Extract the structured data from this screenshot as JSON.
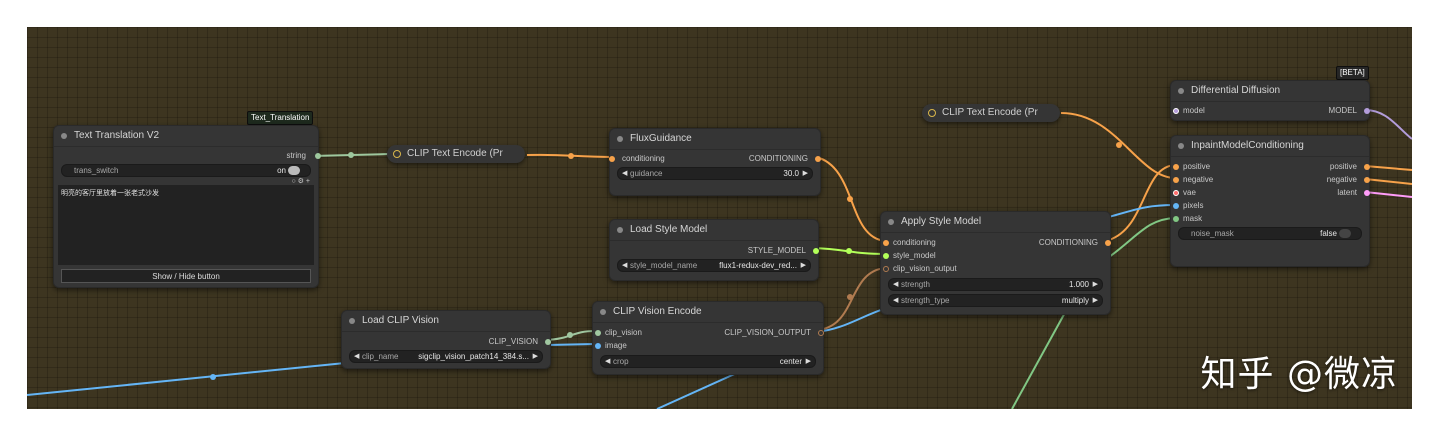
{
  "canvas": {
    "bg": "#3d3520"
  },
  "colors": {
    "conditioning": "#f7a24a",
    "clip_vision": "#a0c7a0",
    "image": "#64b5f6",
    "style_model": "#b2ff59",
    "clip_vision_output": "#b07b50",
    "string": "#9ec89e",
    "mask": "#81c784",
    "model": "#b39ddb",
    "vae": "#ff6e6e",
    "latent": "#ff9cf9"
  },
  "watermark": "知乎 @微凉",
  "nodes": {
    "text_translation": {
      "tag": "Text_Translation",
      "title": "Text Translation V2",
      "output_string": "string",
      "trans_switch_label": "trans_switch",
      "trans_switch_value": "on",
      "text": "明亮的客厅里放着一张老式沙发",
      "button_label": "Show / Hide button"
    },
    "clip_text_encode_1": {
      "title": "CLIP Text Encode (Pr"
    },
    "clip_text_encode_2": {
      "title": "CLIP Text Encode (Pr"
    },
    "flux_guidance": {
      "title": "FluxGuidance",
      "input_conditioning": "conditioning",
      "output_conditioning": "CONDITIONING",
      "guidance_label": "guidance",
      "guidance_value": "30.0"
    },
    "load_style_model": {
      "title": "Load Style Model",
      "output_style_model": "STYLE_MODEL",
      "style_model_name_label": "style_model_name",
      "style_model_name_value": "flux1-redux-dev_red..."
    },
    "apply_style_model": {
      "title": "Apply Style Model",
      "input_conditioning": "conditioning",
      "output_conditioning": "CONDITIONING",
      "input_style_model": "style_model",
      "input_clip_vision_output": "clip_vision_output",
      "strength_label": "strength",
      "strength_value": "1.000",
      "strength_type_label": "strength_type",
      "strength_type_value": "multiply"
    },
    "load_clip_vision": {
      "title": "Load CLIP Vision",
      "output_clip_vision": "CLIP_VISION",
      "clip_name_label": "clip_name",
      "clip_name_value": "sigclip_vision_patch14_384.s..."
    },
    "clip_vision_encode": {
      "title": "CLIP Vision Encode",
      "input_clip_vision": "clip_vision",
      "input_image": "image",
      "output": "CLIP_VISION_OUTPUT",
      "crop_label": "crop",
      "crop_value": "center"
    },
    "differential_diffusion": {
      "tag": "[BETA]",
      "title": "Differential Diffusion",
      "input_model": "model",
      "output_model": "MODEL"
    },
    "inpaint_model_conditioning": {
      "title": "InpaintModelConditioning",
      "input_positive": "positive",
      "input_negative": "negative",
      "input_vae": "vae",
      "input_pixels": "pixels",
      "input_mask": "mask",
      "output_positive": "positive",
      "output_negative": "negative",
      "output_latent": "latent",
      "noise_mask_label": "noise_mask",
      "noise_mask_value": "false"
    }
  }
}
